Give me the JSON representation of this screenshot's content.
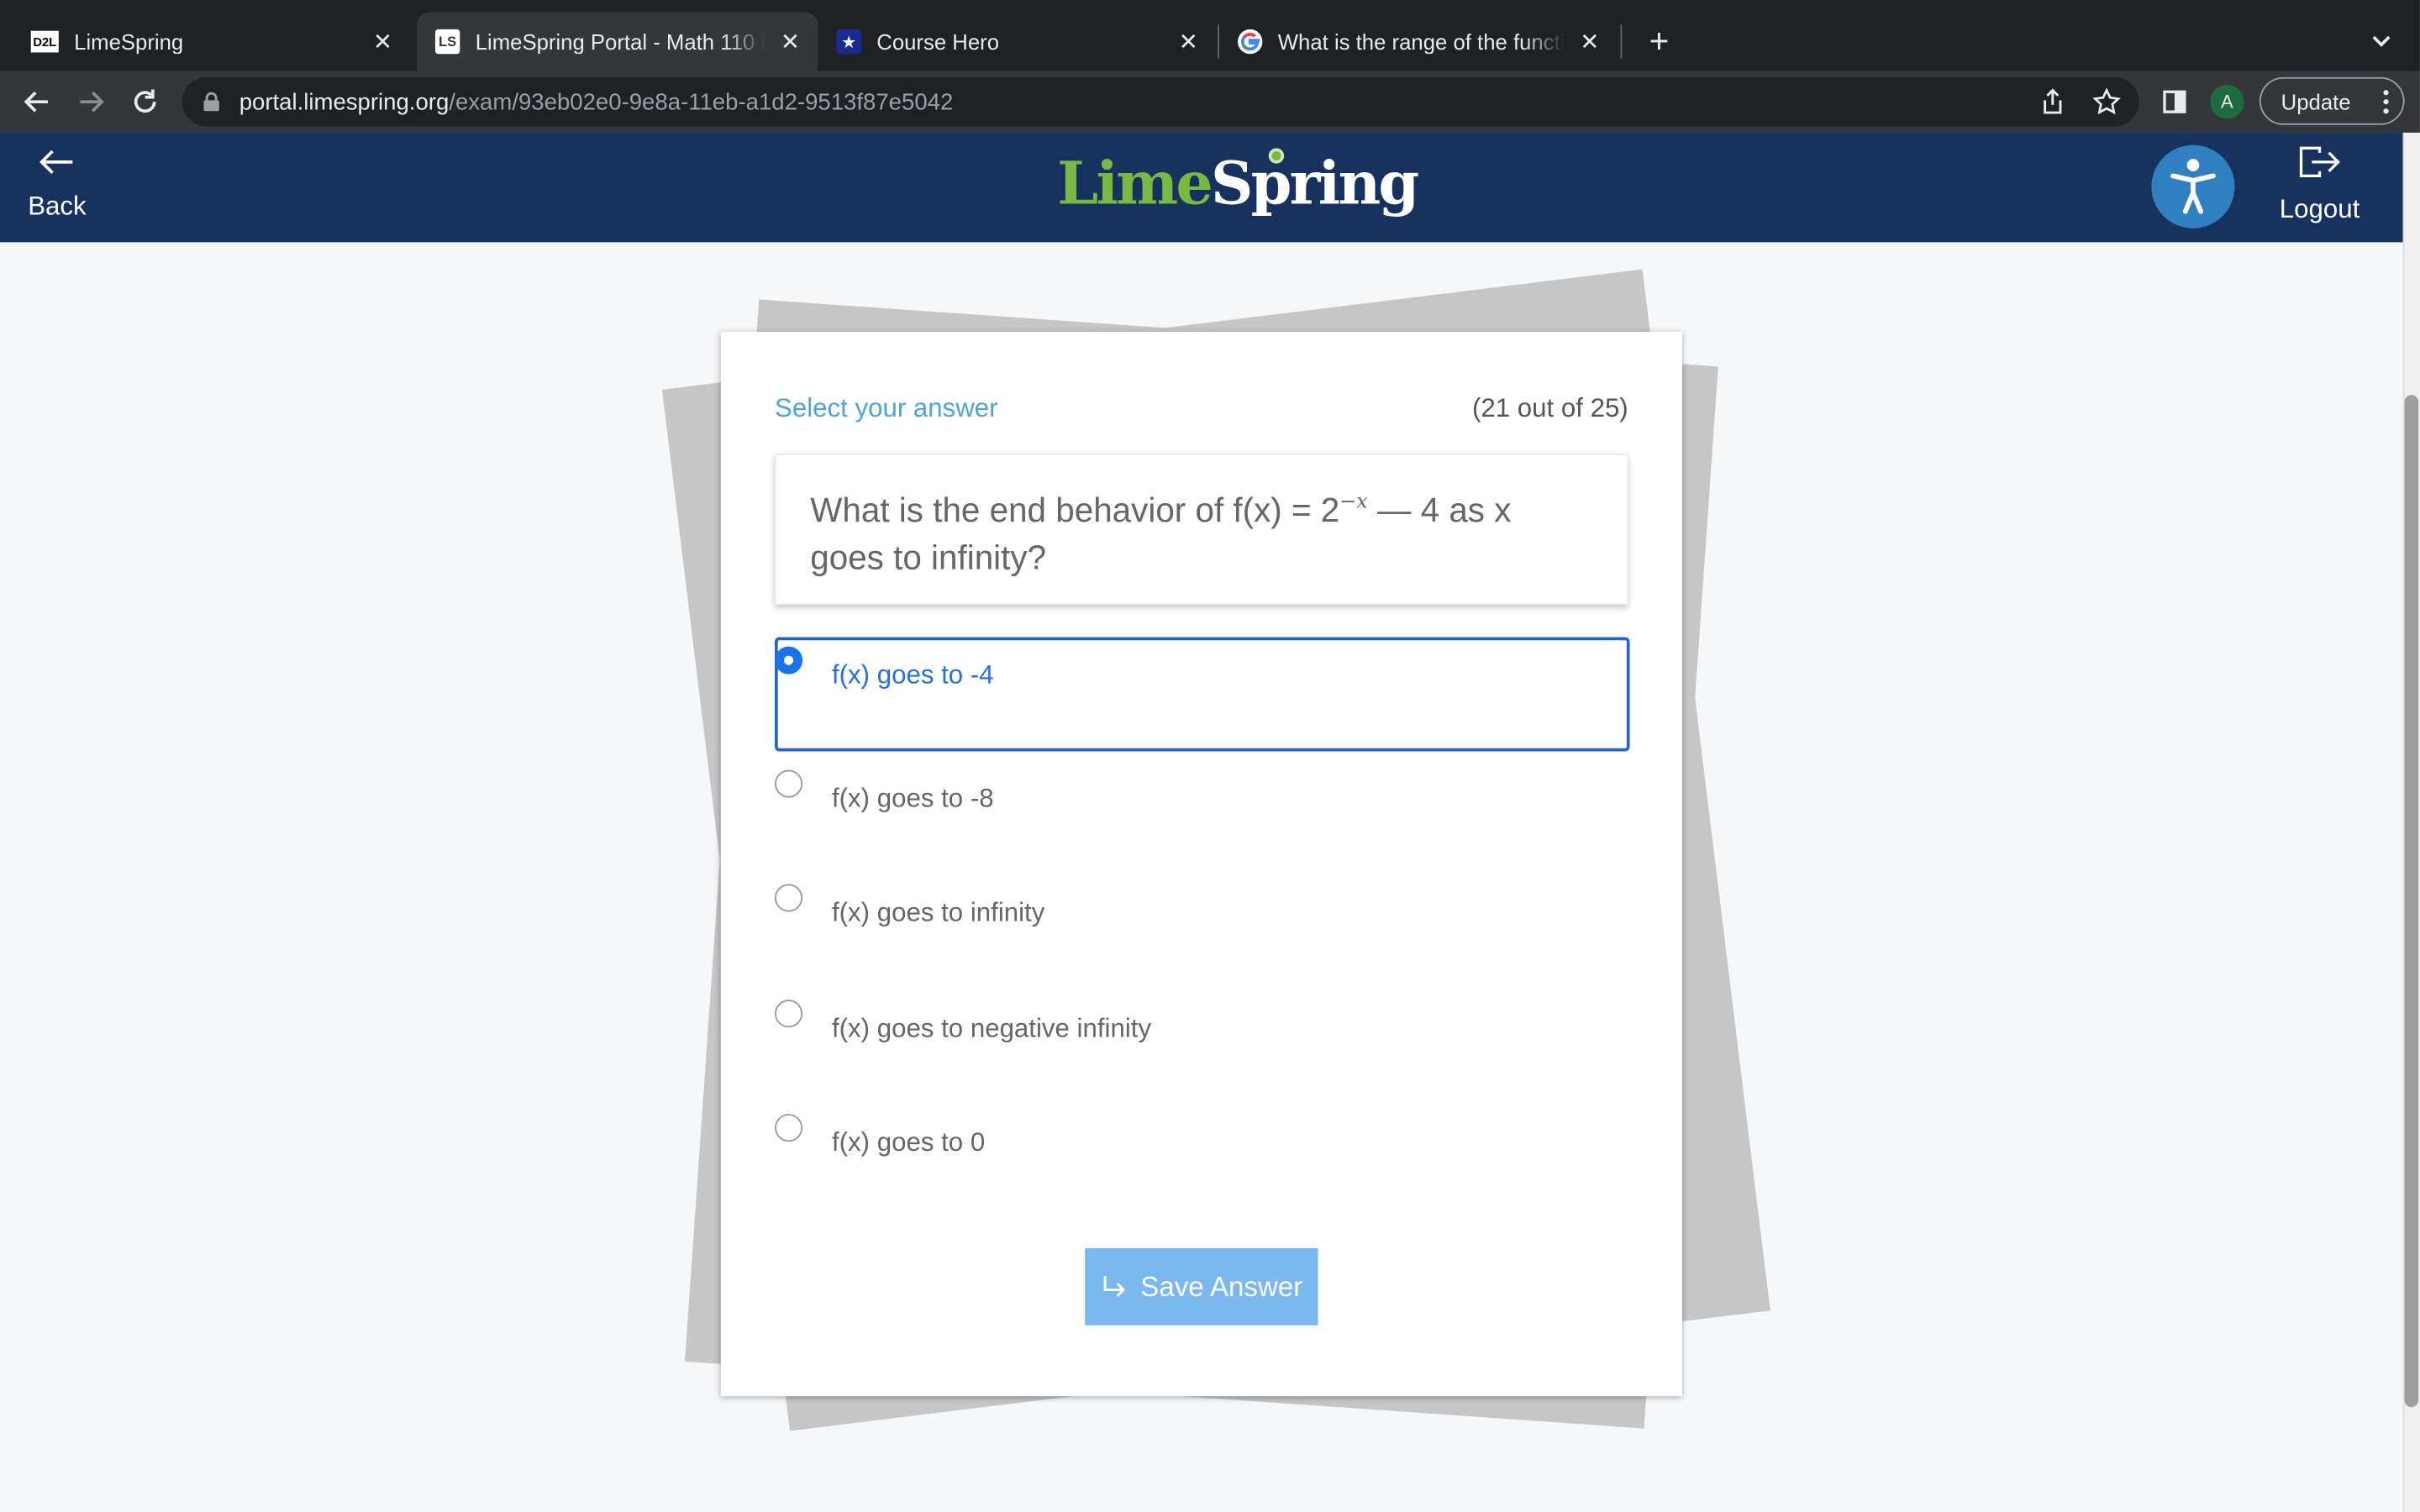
{
  "browser": {
    "tabs": [
      {
        "favicon": "D2L",
        "title": "LimeSpring",
        "active": false
      },
      {
        "favicon": "LS",
        "title": "LimeSpring Portal - Math 110 F",
        "active": true
      },
      {
        "favicon": "star-icon",
        "title": "Course Hero",
        "active": false
      },
      {
        "favicon": "google-icon",
        "title": "What is the range of the functio",
        "active": false
      }
    ],
    "url_host": "portal.limespring.org",
    "url_path": "/exam/93eb02e0-9e8a-11eb-a1d2-9513f87e5042",
    "profile_initial": "A",
    "update_label": "Update"
  },
  "header": {
    "back_label": "Back",
    "logo_lime": "Lime",
    "logo_spring": "Spring",
    "logout_label": "Logout",
    "colors": {
      "bar": "#17325f",
      "lime": "#79b843",
      "accessibility": "#2f7fc1"
    }
  },
  "question": {
    "prompt": "Select your answer",
    "counter": "(21 out of 25)",
    "text_before": "What is the end behavior of f(x) = 2",
    "exponent": "−x",
    "text_after": " — 4 as x goes to infinity?",
    "options": [
      {
        "label": "f(x) goes to -4",
        "selected": true
      },
      {
        "label": "f(x) goes to -8",
        "selected": false
      },
      {
        "label": "f(x) goes to infinity",
        "selected": false
      },
      {
        "label": "f(x) goes to negative infinity",
        "selected": false
      },
      {
        "label": "f(x) goes to 0",
        "selected": false
      }
    ],
    "save_label": "Save Answer",
    "colors": {
      "prompt": "#4ea5d6",
      "selected": "#2465c2",
      "save_button": "#7ab8ee"
    }
  }
}
